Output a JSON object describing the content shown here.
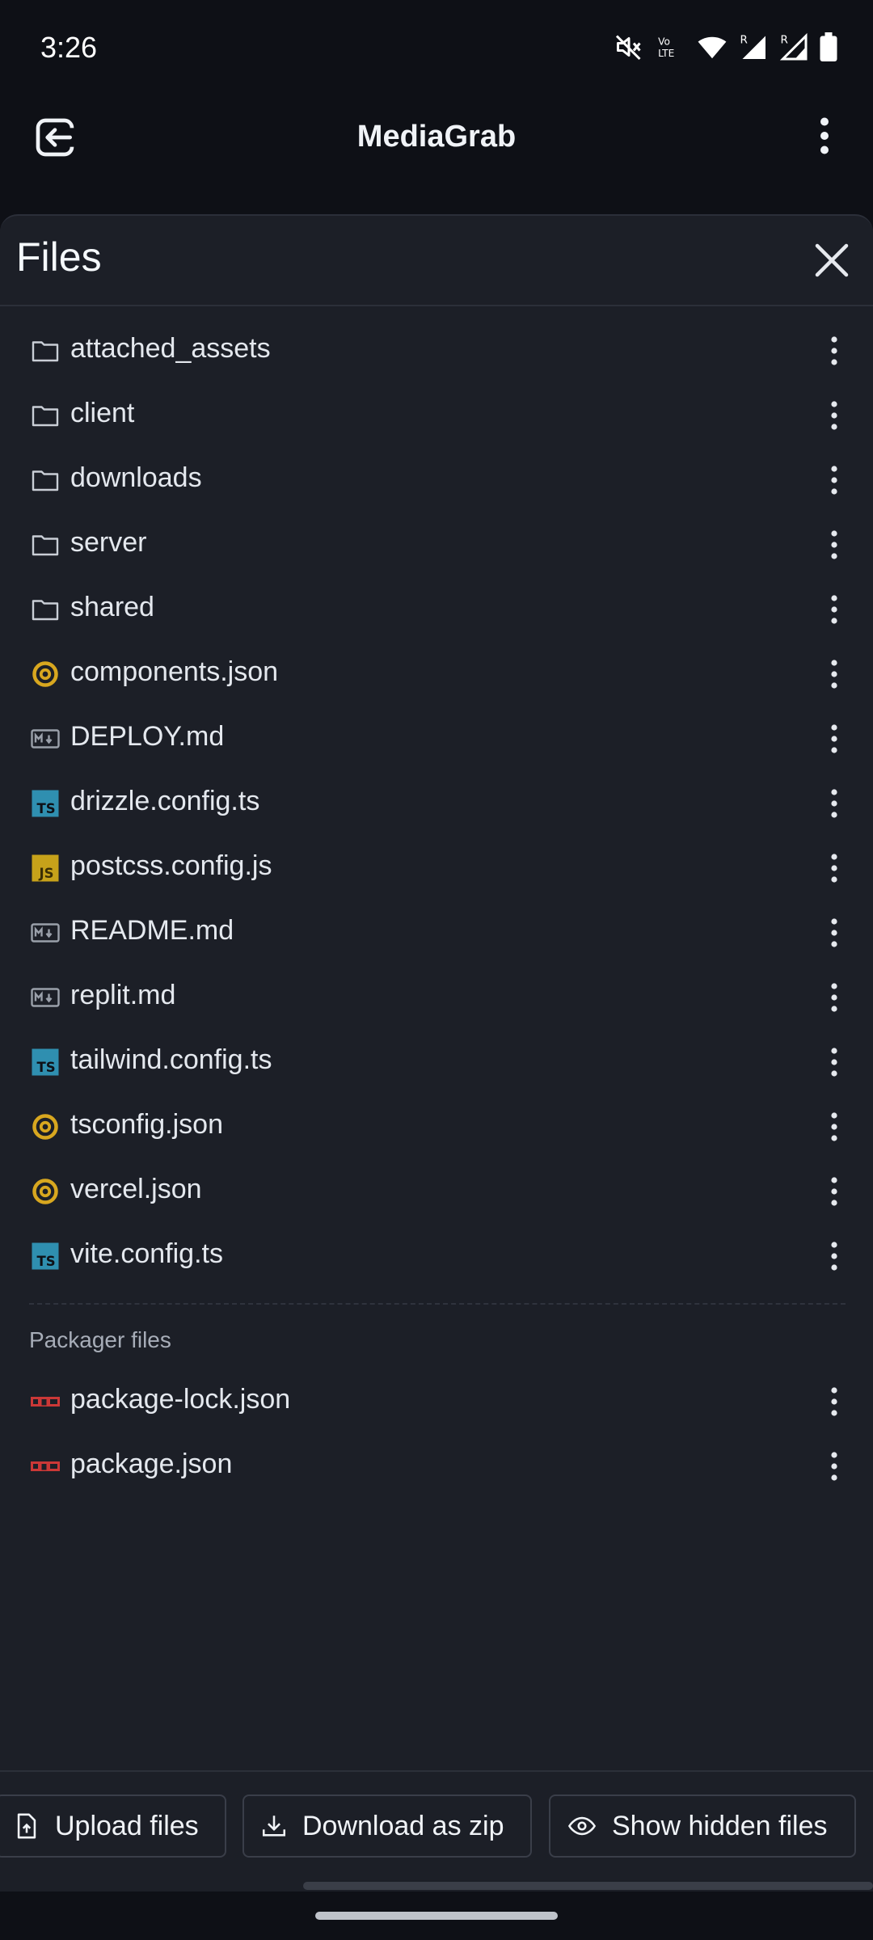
{
  "status_bar": {
    "time": "3:26"
  },
  "header": {
    "title": "MediaGrab"
  },
  "panel": {
    "title": "Files"
  },
  "files": [
    {
      "name": "attached_assets",
      "icon": "folder-icon"
    },
    {
      "name": "client",
      "icon": "folder-icon"
    },
    {
      "name": "downloads",
      "icon": "folder-icon"
    },
    {
      "name": "server",
      "icon": "folder-icon"
    },
    {
      "name": "shared",
      "icon": "folder-icon"
    },
    {
      "name": "components.json",
      "icon": "json-icon"
    },
    {
      "name": "DEPLOY.md",
      "icon": "markdown-icon"
    },
    {
      "name": "drizzle.config.ts",
      "icon": "typescript-icon"
    },
    {
      "name": "postcss.config.js",
      "icon": "javascript-icon"
    },
    {
      "name": "README.md",
      "icon": "markdown-icon"
    },
    {
      "name": "replit.md",
      "icon": "markdown-icon"
    },
    {
      "name": "tailwind.config.ts",
      "icon": "typescript-icon"
    },
    {
      "name": "tsconfig.json",
      "icon": "json-icon"
    },
    {
      "name": "vercel.json",
      "icon": "json-icon"
    },
    {
      "name": "vite.config.ts",
      "icon": "typescript-icon"
    }
  ],
  "packager": {
    "label": "Packager files",
    "files": [
      {
        "name": "package-lock.json",
        "icon": "npm-icon"
      },
      {
        "name": "package.json",
        "icon": "npm-icon"
      }
    ]
  },
  "actions": {
    "upload": "Upload files",
    "download_zip": "Download as zip",
    "show_hidden": "Show hidden files"
  },
  "colors": {
    "background": "#0e1016",
    "panel": "#1c1f27",
    "typescript": "#2f8fb0",
    "javascript": "#c7a21a",
    "json": "#d8a71f",
    "npm": "#cb3837"
  }
}
